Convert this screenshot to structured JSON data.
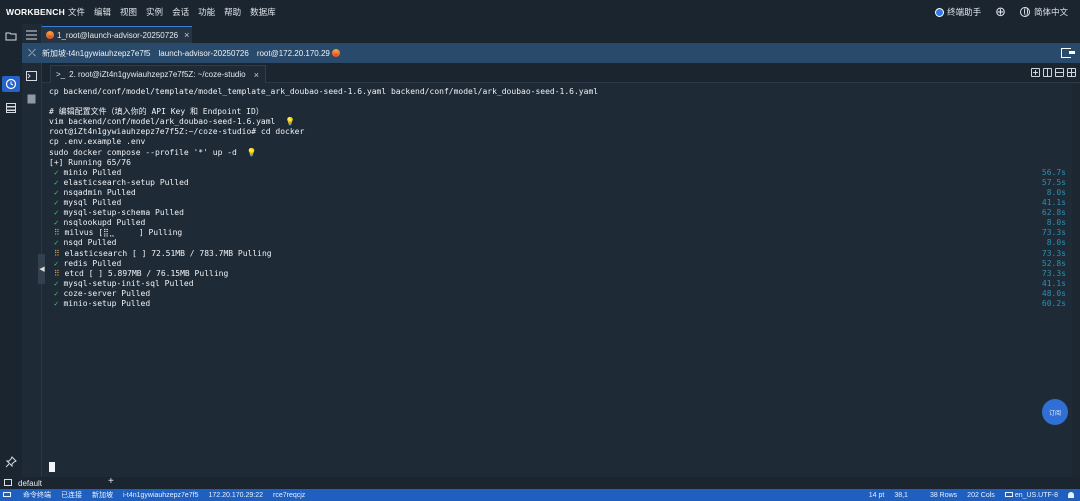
{
  "app": {
    "brand": "WORKBENCH",
    "menu": [
      "文件",
      "编辑",
      "视图",
      "实例",
      "会话",
      "功能",
      "帮助",
      "数据库"
    ],
    "right": {
      "assistant": "终端助手",
      "language": "简体中文"
    }
  },
  "tabs": {
    "session_tab": "1_root@launch-advisor-20250726",
    "close": "×"
  },
  "infobar": {
    "region": "新加坡-t4n1gywiauhzepz7e7f5",
    "instance": "launch-advisor-20250726",
    "host": "root@172.20.170.29"
  },
  "terminal_tab": {
    "prompt_icon": ">_",
    "label": "2. root@iZt4n1gywiauhzepz7e7f5Z: ~/coze-studio",
    "close": "×"
  },
  "terminal": {
    "lines": [
      "cp backend/conf/model/template/model_template_ark_doubao-seed-1.6.yaml backend/conf/model/ark_doubao-seed-1.6.yaml",
      "",
      "# 编辑配置文件（填入你的 API Key 和 Endpoint ID）",
      "vim backend/conf/model/ark_doubao-seed-1.6.yaml",
      "root@iZt4n1gywiauhzepz7e7f5Z:~/coze-studio# cd docker",
      "cp .env.example .env",
      "sudo docker compose --profile '*' up -d",
      "[+] Running 65/76"
    ],
    "services": [
      {
        "mark": "✓",
        "status": "ok",
        "text": "minio Pulled",
        "time": "56.7s"
      },
      {
        "mark": "✓",
        "status": "ok",
        "text": "elasticsearch-setup Pulled",
        "time": "57.5s"
      },
      {
        "mark": "✓",
        "status": "ok",
        "text": "nsqadmin Pulled",
        "time": "8.0s"
      },
      {
        "mark": "✓",
        "status": "ok",
        "text": "mysql Pulled",
        "time": "41.1s"
      },
      {
        "mark": "✓",
        "status": "ok",
        "text": "mysql-setup-schema Pulled",
        "time": "62.8s"
      },
      {
        "mark": "✓",
        "status": "ok",
        "text": "nsqlookupd Pulled",
        "time": "8.0s"
      },
      {
        "mark": "⠿",
        "status": "warn",
        "text": "milvus [⣿⣀     ] Pulling",
        "time": "73.3s"
      },
      {
        "mark": "✓",
        "status": "ok",
        "text": "nsqd Pulled",
        "time": "8.0s"
      },
      {
        "mark": "⠿",
        "status": "warn",
        "text": "elasticsearch [ ] 72.51MB / 783.7MB Pulling",
        "time": "73.3s"
      },
      {
        "mark": "✓",
        "status": "ok",
        "text": "redis Pulled",
        "time": "52.8s"
      },
      {
        "mark": "⠿",
        "status": "warn",
        "text": "etcd [ ] 5.897MB / 76.15MB Pulling",
        "time": "73.3s"
      },
      {
        "mark": "✓",
        "status": "ok",
        "text": "mysql-setup-init-sql Pulled",
        "time": "41.1s"
      },
      {
        "mark": "✓",
        "status": "ok",
        "text": "coze-server Pulled",
        "time": "48.0s"
      },
      {
        "mark": "✓",
        "status": "ok",
        "text": "minio-setup Pulled",
        "time": "60.2s"
      }
    ]
  },
  "float_button": "订阅",
  "panel": {
    "session_name": "default",
    "add": "+"
  },
  "status": {
    "left": [
      "命令终端",
      "已连接",
      "新加坡",
      "i-t4n1gywiauhzepz7e7f5",
      "172.20.170.29:22",
      "rce7reqcjz"
    ],
    "font_size": "14 pt",
    "cursor_pos": "38,1",
    "rows": "38 Rows",
    "cols": "202 Cols",
    "locale": "en_US.UTF-8"
  },
  "colors": {
    "accent": "#2563c9",
    "statusbar": "#1f5fbf",
    "ok": "#4ac25a",
    "warn": "#e8a33c",
    "time": "#2f8fb0"
  }
}
